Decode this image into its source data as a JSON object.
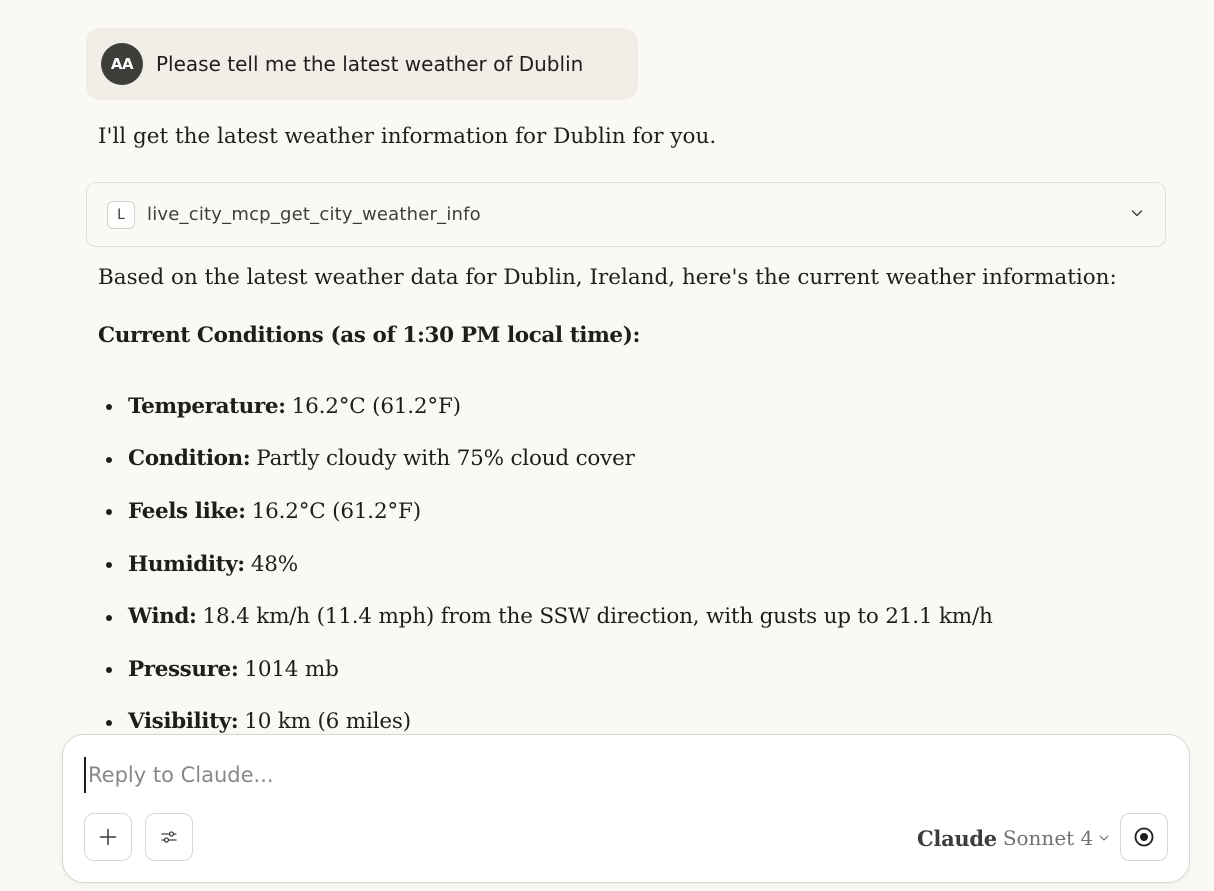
{
  "user_message": {
    "avatar_initials": "AA",
    "text": "Please tell me the latest weather of Dublin"
  },
  "assistant": {
    "intro": "I'll get the latest weather information for Dublin for you.",
    "tool_call": {
      "badge": "L",
      "name": "live_city_mcp_get_city_weather_info",
      "icon": "chevron-down-icon"
    },
    "summary": "Based on the latest weather data for Dublin, Ireland, here's the current weather information:",
    "heading": "Current Conditions (as of 1:30 PM local time):",
    "items": [
      {
        "label": "Temperature:",
        "value": "16.2°C (61.2°F)"
      },
      {
        "label": "Condition:",
        "value": "Partly cloudy with 75% cloud cover"
      },
      {
        "label": "Feels like:",
        "value": "16.2°C (61.2°F)"
      },
      {
        "label": "Humidity:",
        "value": "48%"
      },
      {
        "label": "Wind:",
        "value": "18.4 km/h (11.4 mph) from the SSW direction, with gusts up to 21.1 km/h"
      },
      {
        "label": "Pressure:",
        "value": "1014 mb"
      },
      {
        "label": "Visibility:",
        "value": "10 km (6 miles)"
      }
    ]
  },
  "composer": {
    "placeholder": "Reply to Claude...",
    "value": "",
    "add_icon": "plus-icon",
    "tools_icon": "sliders-icon",
    "model_brand": "Claude",
    "model_name": "Sonnet 4",
    "voice_icon": "voice-mode-icon"
  }
}
